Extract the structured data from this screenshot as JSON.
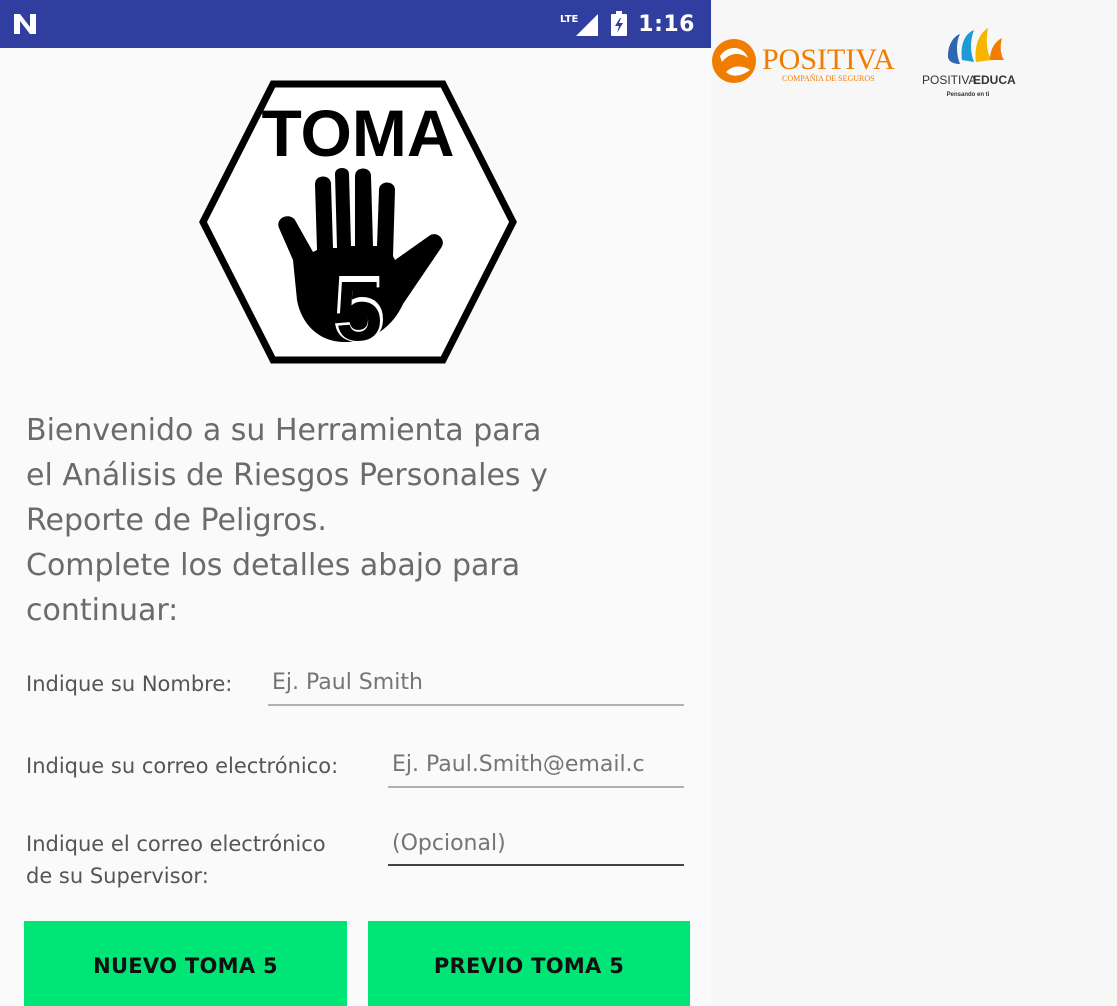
{
  "status_bar": {
    "network": "LTE",
    "time": "1:16"
  },
  "app_logo": {
    "title": "TOMA",
    "number": "5"
  },
  "welcome": {
    "lines": [
      "Bienvenido a su Herramienta para",
      "el Análisis de Riesgos Personales y",
      "Reporte de Peligros.",
      "Complete los detalles abajo para",
      "continuar:"
    ]
  },
  "form": {
    "name": {
      "label": "Indique su Nombre:",
      "placeholder": "Ej. Paul Smith",
      "value": ""
    },
    "email": {
      "label": "Indique su correo electrónico:",
      "placeholder": "Ej. Paul.Smith@email.c",
      "value": ""
    },
    "supervisor": {
      "label_line1": "Indique el correo electrónico",
      "label_line2": "de su Supervisor:",
      "placeholder": "(Opcional)",
      "value": ""
    }
  },
  "buttons": {
    "new": "NUEVO TOMA 5",
    "previous": "PREVIO TOMA 5"
  },
  "brand": {
    "positiva_name": "POSITIVA",
    "positiva_sub": "COMPAÑIA DE SEGUROS",
    "educa_name_a": "POSITIVA",
    "educa_name_b": "EDUCA",
    "educa_tagline": "Pensando en ti"
  },
  "colors": {
    "status_bar": "#303f9f",
    "button": "#00e676",
    "brand_orange": "#f07d00",
    "brand_blue": "#2e66b0"
  }
}
